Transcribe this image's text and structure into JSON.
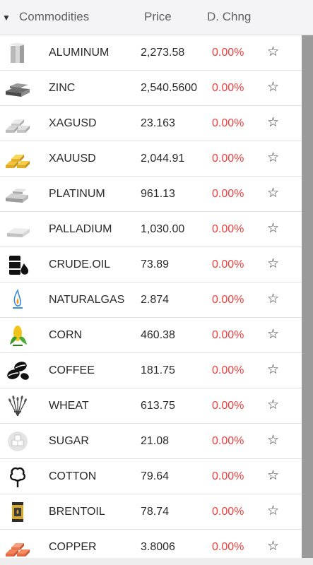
{
  "header": {
    "name_label": "Commodities",
    "price_label": "Price",
    "change_label": "D. Chng",
    "sort_icon": "triangle-down-icon"
  },
  "rows": [
    {
      "name": "ALUMINUM",
      "price": "2,273.58",
      "change": "0.00%",
      "icon": "aluminum-icon"
    },
    {
      "name": "ZINC",
      "price": "2,540.5600",
      "change": "0.00%",
      "icon": "zinc-bars-icon"
    },
    {
      "name": "XAGUSD",
      "price": "23.163",
      "change": "0.00%",
      "icon": "silver-bars-icon"
    },
    {
      "name": "XAUUSD",
      "price": "2,044.91",
      "change": "0.00%",
      "icon": "gold-bars-icon"
    },
    {
      "name": "PLATINUM",
      "price": "961.13",
      "change": "0.00%",
      "icon": "platinum-bars-icon"
    },
    {
      "name": "PALLADIUM",
      "price": "1,030.00",
      "change": "0.00%",
      "icon": "palladium-bar-icon"
    },
    {
      "name": "CRUDE.OIL",
      "price": "73.89",
      "change": "0.00%",
      "icon": "oil-barrel-icon"
    },
    {
      "name": "NATURALGAS",
      "price": "2.874",
      "change": "0.00%",
      "icon": "gas-flame-icon"
    },
    {
      "name": "CORN",
      "price": "460.38",
      "change": "0.00%",
      "icon": "corn-icon"
    },
    {
      "name": "COFFEE",
      "price": "181.75",
      "change": "0.00%",
      "icon": "coffee-beans-icon"
    },
    {
      "name": "WHEAT",
      "price": "613.75",
      "change": "0.00%",
      "icon": "wheat-icon"
    },
    {
      "name": "SUGAR",
      "price": "21.08",
      "change": "0.00%",
      "icon": "sugar-cubes-icon"
    },
    {
      "name": "COTTON",
      "price": "79.64",
      "change": "0.00%",
      "icon": "cotton-icon"
    },
    {
      "name": "BRENTOIL",
      "price": "78.74",
      "change": "0.00%",
      "icon": "oil-can-icon"
    },
    {
      "name": "COPPER",
      "price": "3.8006",
      "change": "0.00%",
      "icon": "copper-bars-icon"
    }
  ],
  "colors": {
    "change_negative": "#ef3d3d",
    "header_bg": "#f4f4f6",
    "scrollbar": "#9a9a9a"
  }
}
